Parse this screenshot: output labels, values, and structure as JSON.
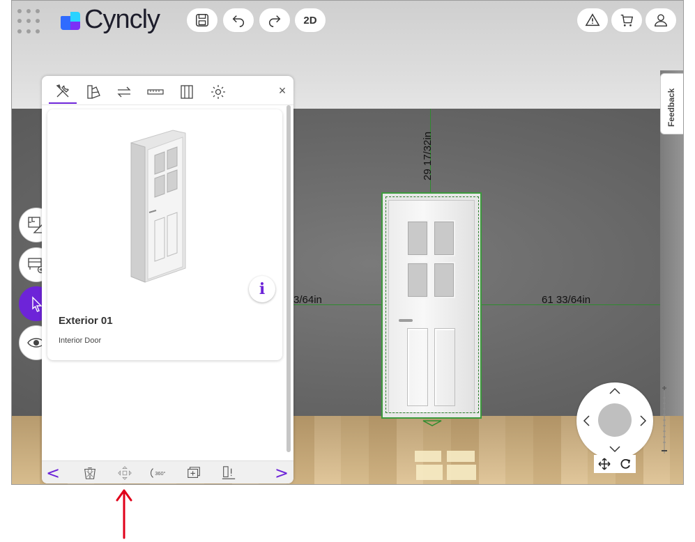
{
  "app": {
    "brand": "Cyncly",
    "brand_colors": {
      "blue": "#2f6bff",
      "purple": "#7b2ff7",
      "cyan": "#2ad3ff",
      "accent": "#6d24d8"
    }
  },
  "toolbar": {
    "view_mode_label": "2D",
    "icons": [
      "save-icon",
      "undo-icon",
      "redo-icon",
      "warning-icon",
      "cart-icon",
      "user-icon"
    ]
  },
  "feedback": {
    "label": "Feedback"
  },
  "scene": {
    "dimensions": {
      "top": "29 17/32in",
      "left": "3/64in",
      "right": "61 33/64in"
    }
  },
  "side_tools": {
    "items": [
      {
        "name": "floorplan-tool-icon"
      },
      {
        "name": "add-furniture-icon"
      },
      {
        "name": "select-cursor-icon",
        "active": true
      },
      {
        "name": "view-eye-icon"
      }
    ]
  },
  "panel": {
    "tabs": [
      {
        "name": "tools-tab-icon",
        "active": true
      },
      {
        "name": "materials-tab-icon"
      },
      {
        "name": "swap-tab-icon"
      },
      {
        "name": "measure-tab-icon"
      },
      {
        "name": "layout-tab-icon"
      },
      {
        "name": "settings-tab-icon"
      }
    ],
    "close_label": "×",
    "item": {
      "title": "Exterior 01",
      "subtitle": "Interior Door",
      "info_label": "i"
    },
    "bottom_actions": {
      "prev_label": "<",
      "next_label": ">",
      "icons": [
        "delete-basket-icon",
        "move-icon",
        "rotate-360-icon",
        "duplicate-icon",
        "align-icon"
      ]
    }
  },
  "navigator": {
    "up": "^",
    "down": "v",
    "left": "<",
    "right": ">",
    "icons": [
      "pan-icon",
      "orbit-icon"
    ]
  },
  "annotation": {
    "arrow_color": "#e0001a"
  }
}
